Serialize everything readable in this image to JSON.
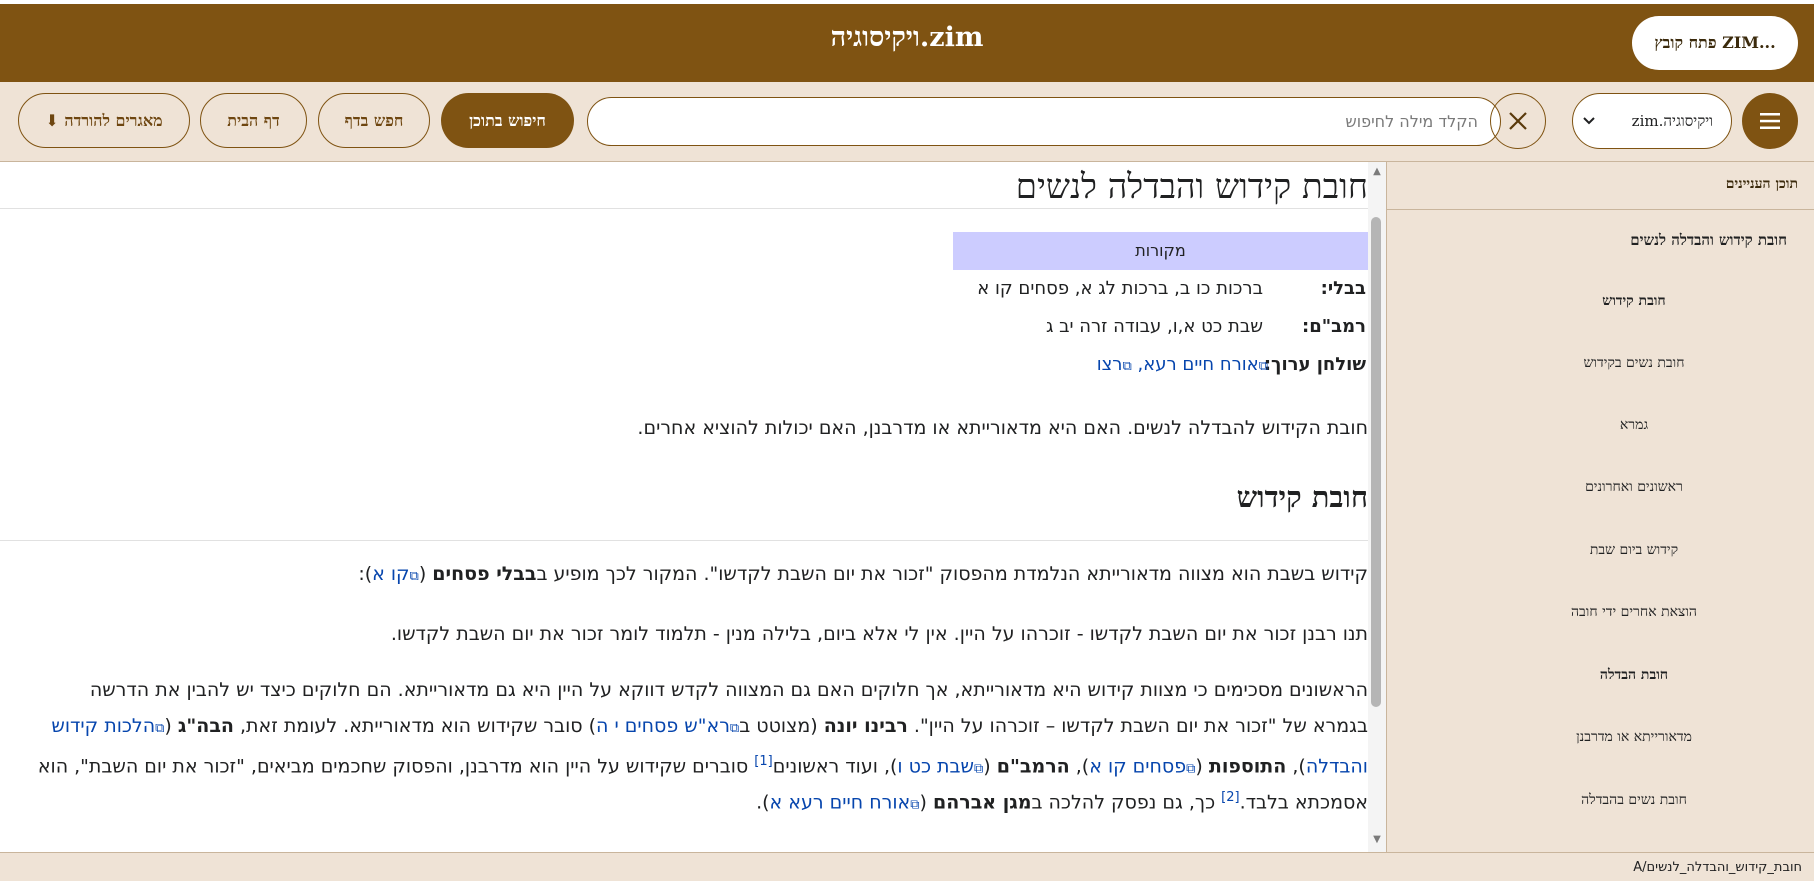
{
  "header": {
    "title": "ויקיסוגיה.zim",
    "open_button": "פתח קובץ ZIM..."
  },
  "toolbar": {
    "download_button": "⬇ מאגרים להורדה",
    "home_button": "דף הבית",
    "find_in_page_button": "חפש בדף",
    "search_content_button": "חיפוש בתוכן",
    "search_placeholder": "הקלד מילה לחיפוש",
    "book_select_value": "ויקיסוגיה.zim"
  },
  "sidebar": {
    "title": "תוכן העניינים",
    "items": [
      "חובת קידוש והבדלה לנשים",
      "חובת קידוש",
      "חובת נשים בקידוש",
      "גמרא",
      "ראשונים ואחרונים",
      "קידוש ביום שבת",
      "הוצאת אחרים ידי חובה",
      "חובת הבדלה",
      "מדאורייתא או מדרבנן",
      "חובת נשים בהבדלה"
    ]
  },
  "article": {
    "title": "חובת קידוש והבדלה לנשים",
    "sources_heading": "מקורות",
    "sources": [
      {
        "label": "בבלי:",
        "value": "ברכות כו ב, ברכות לג א, פסחים קו א"
      },
      {
        "label": "רמב\"ם:",
        "value": "שבת כט א,ו, עבודה זרה יב ג"
      },
      {
        "label": "שולחן ערוך:",
        "link1": "אורח חיים רעא",
        "sep": ", ",
        "link2": "רצו"
      }
    ],
    "intro": "חובת הקידוש להבדלה לנשים. האם היא מדאורייתא או מדרבנן, האם יכולות להוציא אחרים.",
    "section1_heading": "חובת קידוש",
    "p1": {
      "a": "קידוש בשבת הוא מצווה מדאורייתא הנלמדת מהפסוק \"זכור את יום השבת לקדשו\". המקור לכך מופיע ב",
      "b": "בבלי פסחים",
      "c": " (",
      "link": "קו א",
      "d": "):"
    },
    "p2": "תנו רבנן זכור את יום השבת לקדשו - זוכרהו על היין. אין לי אלא ביום, בלילה מנין - תלמוד לומר זכור את יום השבת לקדשו.",
    "p3": {
      "line1": "הראשונים מסכימים כי מצוות קידוש היא מדאורייתא, אך חלוקים האם גם המצווה לקדש דווקא על היין היא גם מדאורייתא. הם חלוקים כיצד יש להבין את הדרשה",
      "l2a": "בגמרא של \"זכור את יום השבת לקדשו – זוכרהו על היין\". ",
      "l2b": "רבינו יונה",
      "l2c": " (מצוטט ב",
      "l2link1": "רא\"ש פסחים י ה",
      "l2d": ") סובר שקידוש הוא מדאורייתא. לעומת זאת, ",
      "l2e": "הבה\"ג",
      "l2f": " (",
      "l2link2": "הלכות קידוש",
      "l3link1": "והבדלה",
      "l3a": "), ",
      "l3b": "התוספות",
      "l3c": " (",
      "l3link2": "פסחים קו א",
      "l3d": "), ",
      "l3e": "הרמב\"ם",
      "l3f": " (",
      "l3link3": "שבת כט ו",
      "l3g": "), ועוד ראשונים",
      "l3sup": "[1]",
      "l3h": " סוברים שקידוש על היין הוא מדרבנן, והפסוק שחכמים מביאים, \"זכור את יום השבת\", הוא",
      "l4a": "אסמכתא בלבד.",
      "l4sup": "[2]",
      "l4b": " כך, גם נפסק להלכה ב",
      "l4c": "מגן אברהם",
      "l4d": " (",
      "l4link": "אורח חיים רעא א",
      "l4e": ")."
    }
  },
  "statusbar": {
    "path": "A/חובת_קידוש_והבדלה_לנשים"
  }
}
